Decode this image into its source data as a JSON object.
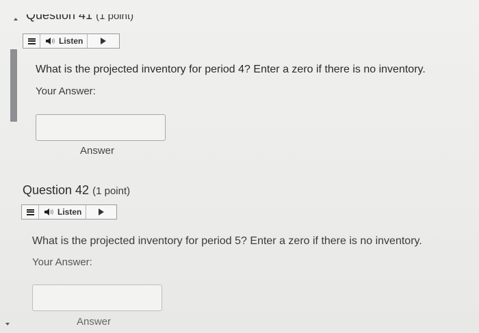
{
  "questions": [
    {
      "title": "Question 41",
      "points": "(1 point)",
      "listen": {
        "label": "Listen"
      },
      "text": "What is the projected inventory for period 4? Enter a zero if there is no inventory.",
      "your_answer_label": "Your Answer:",
      "input_value": "",
      "input_caption": "Answer"
    },
    {
      "title": "Question 42",
      "points": "(1 point)",
      "listen": {
        "label": "Listen"
      },
      "text": "What is the projected inventory for period 5? Enter a zero if there is no inventory.",
      "your_answer_label": "Your Answer:",
      "input_value": "",
      "input_caption": "Answer"
    }
  ],
  "icons": {
    "menu": "hamburger-menu-icon",
    "speaker": "speaker-icon",
    "play": "play-icon"
  },
  "colors": {
    "background": "#ececea",
    "text": "#2a2a2a",
    "scroll_indicator": "#8d8f92"
  }
}
